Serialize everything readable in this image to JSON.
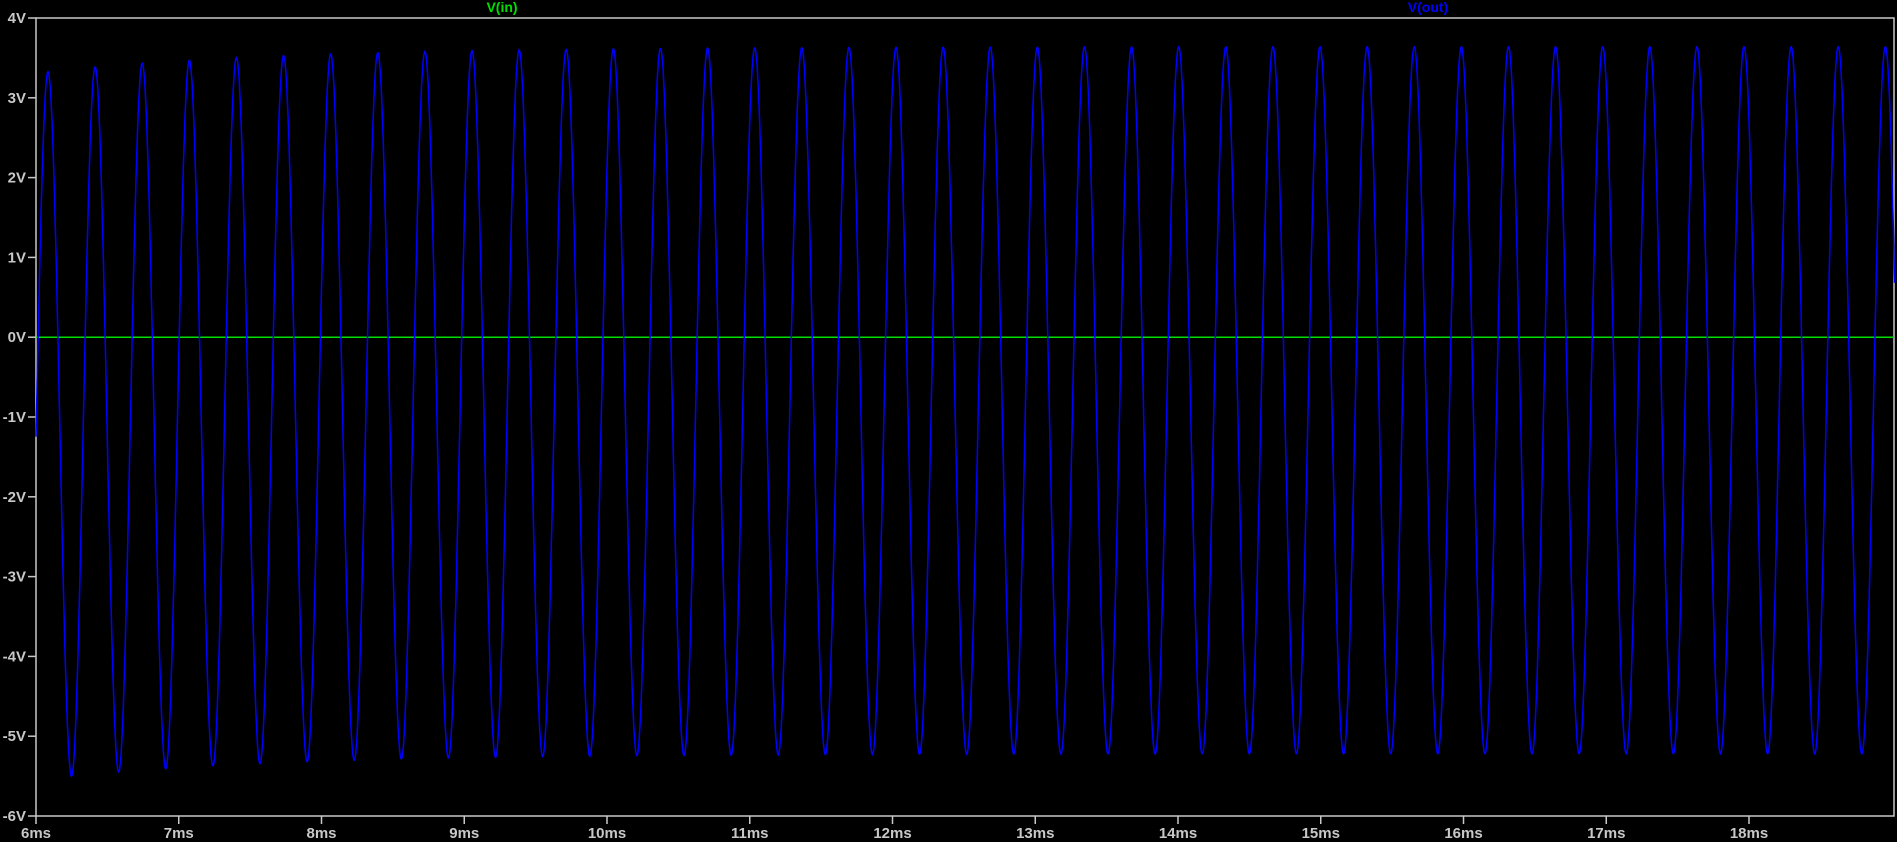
{
  "chart_data": {
    "type": "line",
    "title": "",
    "xlabel": "",
    "ylabel": "",
    "xlim": [
      6.0,
      19.02
    ],
    "ylim": [
      -6,
      4
    ],
    "grid": false,
    "x_ticks": [
      "6ms",
      "7ms",
      "8ms",
      "9ms",
      "10ms",
      "11ms",
      "12ms",
      "13ms",
      "14ms",
      "15ms",
      "16ms",
      "17ms",
      "18ms"
    ],
    "x_tick_values": [
      6,
      7,
      8,
      9,
      10,
      11,
      12,
      13,
      14,
      15,
      16,
      17,
      18
    ],
    "y_ticks": [
      "4V",
      "3V",
      "2V",
      "1V",
      "0V",
      "-1V",
      "-2V",
      "-3V",
      "-4V",
      "-5V",
      "-6V"
    ],
    "y_tick_values": [
      4,
      3,
      2,
      1,
      0,
      -1,
      -2,
      -3,
      -4,
      -5,
      -6
    ],
    "x_unit": "ms",
    "y_unit": "V",
    "series": [
      {
        "name": "V(in)",
        "color": "#00e000",
        "type": "constant",
        "value": 0
      },
      {
        "name": "V(out)",
        "color": "#0000ff",
        "type": "sine",
        "frequency_khz": 3.03,
        "first_peak_ms": 6.084,
        "amplitude": 4.43,
        "offset_final": -0.79,
        "offset_initial_delta": -0.33,
        "offset_time_constant_ms": 1.6,
        "approx_peaks": {
          "start": 3.33,
          "end": 3.65
        },
        "approx_troughs": {
          "start": -5.53,
          "end": -5.22
        }
      }
    ]
  }
}
